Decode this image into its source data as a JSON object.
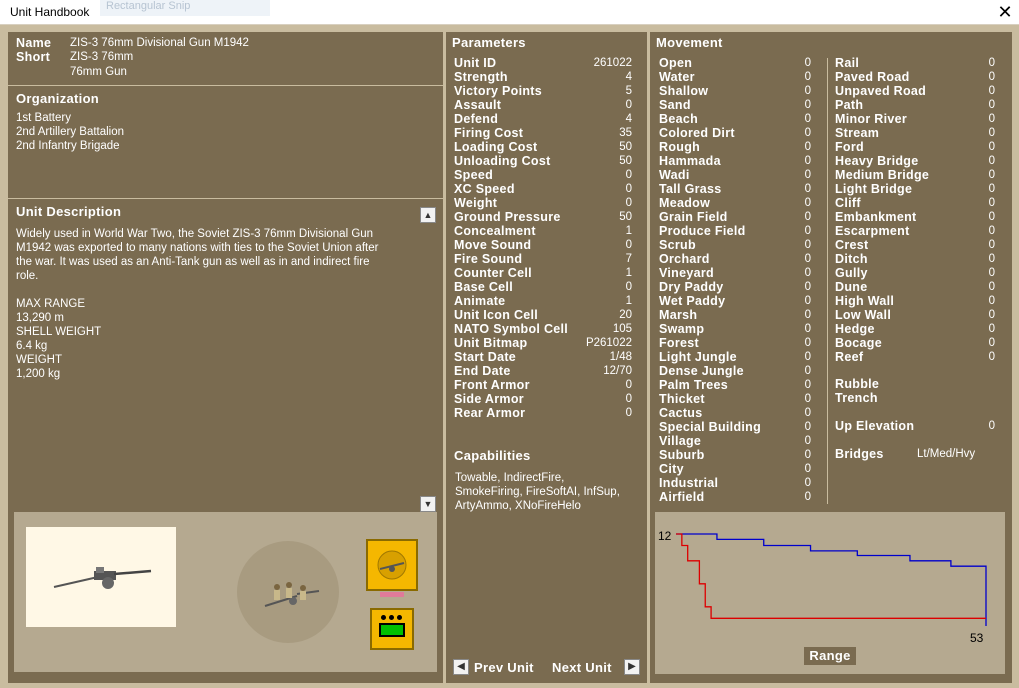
{
  "window": {
    "title": "Unit Handbook",
    "ghost_text": "Rectangular Snip"
  },
  "colors": {
    "panel": "#7a6b50",
    "frame": "#c9bc9f",
    "inset": "#b5a990",
    "blue_line": "#0000cc",
    "red_line": "#dd0000"
  },
  "unit": {
    "name_label": "Name",
    "short_label": "Short",
    "name": "ZIS-3 76mm Divisional Gun M1942",
    "short1": "ZIS-3 76mm",
    "short2": "76mm Gun"
  },
  "organization": {
    "header": "Organization",
    "lines": [
      "1st Battery",
      "2nd Artillery Battalion",
      "2nd Infantry Brigade"
    ]
  },
  "description": {
    "header": "Unit Description",
    "lines": [
      "Widely used in World War Two, the Soviet ZIS-3 76mm Divisional Gun",
      "M1942 was exported to many nations with ties to the Soviet Union after",
      "the war. It was used as an Anti-Tank gun as well as in and indirect fire",
      "role.",
      "",
      "MAX RANGE",
      "13,290 m",
      "SHELL WEIGHT",
      "6.4 kg",
      "WEIGHT",
      "1,200 kg"
    ]
  },
  "parameters": {
    "header": "Parameters",
    "rows": [
      {
        "label": "Unit ID",
        "value": "261022"
      },
      {
        "label": "Strength",
        "value": "4"
      },
      {
        "label": "Victory Points",
        "value": "5"
      },
      {
        "label": "Assault",
        "value": "0"
      },
      {
        "label": "Defend",
        "value": "4"
      },
      {
        "label": "Firing Cost",
        "value": "35"
      },
      {
        "label": "Loading Cost",
        "value": "50"
      },
      {
        "label": "Unloading Cost",
        "value": "50"
      },
      {
        "label": "Speed",
        "value": "0"
      },
      {
        "label": "XC Speed",
        "value": "0"
      },
      {
        "label": "Weight",
        "value": "0"
      },
      {
        "label": "Ground Pressure",
        "value": "50"
      },
      {
        "label": "Concealment",
        "value": "1"
      },
      {
        "label": "Move Sound",
        "value": "0"
      },
      {
        "label": "Fire Sound",
        "value": "7"
      },
      {
        "label": "Counter Cell",
        "value": "1"
      },
      {
        "label": "Base Cell",
        "value": "0"
      },
      {
        "label": "Animate",
        "value": "1"
      },
      {
        "label": "Unit Icon Cell",
        "value": "20"
      },
      {
        "label": "NATO Symbol Cell",
        "value": "105"
      },
      {
        "label": "Unit Bitmap",
        "value": "P261022"
      },
      {
        "label": "Start Date",
        "value": "1/48"
      },
      {
        "label": "End Date",
        "value": "12/70"
      },
      {
        "label": "Front Armor",
        "value": "0"
      },
      {
        "label": "Side Armor",
        "value": "0"
      },
      {
        "label": "Rear Armor",
        "value": "0"
      }
    ]
  },
  "capabilities": {
    "header": "Capabilities",
    "lines": [
      "Towable, IndirectFire,",
      "SmokeFiring, FireSoftAI, InfSup,",
      "ArtyAmmo, XNoFireHelo"
    ]
  },
  "movement": {
    "header": "Movement",
    "col1": [
      {
        "label": "Open",
        "value": "0"
      },
      {
        "label": "Water",
        "value": "0"
      },
      {
        "label": "Shallow",
        "value": "0"
      },
      {
        "label": "Sand",
        "value": "0"
      },
      {
        "label": "Beach",
        "value": "0"
      },
      {
        "label": "Colored Dirt",
        "value": "0"
      },
      {
        "label": "Rough",
        "value": "0"
      },
      {
        "label": "Hammada",
        "value": "0"
      },
      {
        "label": "Wadi",
        "value": "0"
      },
      {
        "label": "Tall Grass",
        "value": "0"
      },
      {
        "label": "Meadow",
        "value": "0"
      },
      {
        "label": "Grain Field",
        "value": "0"
      },
      {
        "label": "Produce Field",
        "value": "0"
      },
      {
        "label": "Scrub",
        "value": "0"
      },
      {
        "label": "Orchard",
        "value": "0"
      },
      {
        "label": "Vineyard",
        "value": "0"
      },
      {
        "label": "Dry Paddy",
        "value": "0"
      },
      {
        "label": "Wet Paddy",
        "value": "0"
      },
      {
        "label": "Marsh",
        "value": "0"
      },
      {
        "label": "Swamp",
        "value": "0"
      },
      {
        "label": "Forest",
        "value": "0"
      },
      {
        "label": "Light Jungle",
        "value": "0"
      },
      {
        "label": "Dense Jungle",
        "value": "0"
      },
      {
        "label": "Palm Trees",
        "value": "0"
      },
      {
        "label": "Thicket",
        "value": "0"
      },
      {
        "label": "Cactus",
        "value": "0"
      },
      {
        "label": "Special Building",
        "value": "0"
      },
      {
        "label": "Village",
        "value": "0"
      },
      {
        "label": "Suburb",
        "value": "0"
      },
      {
        "label": "City",
        "value": "0"
      },
      {
        "label": "Industrial",
        "value": "0"
      },
      {
        "label": "Airfield",
        "value": "0"
      }
    ],
    "col2": [
      {
        "label": "Rail",
        "value": "0"
      },
      {
        "label": "Paved Road",
        "value": "0"
      },
      {
        "label": "Unpaved Road",
        "value": "0"
      },
      {
        "label": "Path",
        "value": "0"
      },
      {
        "label": "Minor River",
        "value": "0"
      },
      {
        "label": "Stream",
        "value": "0"
      },
      {
        "label": "Ford",
        "value": "0"
      },
      {
        "label": "Heavy Bridge",
        "value": "0"
      },
      {
        "label": "Medium Bridge",
        "value": "0"
      },
      {
        "label": "Light Bridge",
        "value": "0"
      },
      {
        "label": "Cliff",
        "value": "0"
      },
      {
        "label": "Embankment",
        "value": "0"
      },
      {
        "label": "Escarpment",
        "value": "0"
      },
      {
        "label": "Crest",
        "value": "0"
      },
      {
        "label": "Ditch",
        "value": "0"
      },
      {
        "label": "Gully",
        "value": "0"
      },
      {
        "label": "Dune",
        "value": "0"
      },
      {
        "label": "High Wall",
        "value": "0"
      },
      {
        "label": "Low Wall",
        "value": "0"
      },
      {
        "label": "Hedge",
        "value": "0"
      },
      {
        "label": "Bocage",
        "value": "0"
      },
      {
        "label": "Reef",
        "value": "0"
      }
    ],
    "rubble": "Rubble",
    "trench": "Trench",
    "up_elevation": {
      "label": "Up Elevation",
      "value": "0"
    },
    "bridges": {
      "label": "Bridges",
      "value": "Lt/Med/Hvy"
    }
  },
  "nav": {
    "prev": "Prev Unit",
    "next": "Next Unit"
  },
  "icons": {
    "scroll_up": "scroll-up-icon",
    "scroll_down": "scroll-down-icon",
    "prev": "prev-arrow-icon",
    "next": "next-arrow-icon",
    "close": "close-icon"
  },
  "chart_data": {
    "type": "line",
    "xlabel": "Range",
    "x_min": 0,
    "x_max": 53,
    "y_max": 12,
    "y_tick_label": "12",
    "x_tick_label": "53",
    "series": [
      {
        "color": "#0000cc",
        "points": [
          [
            0,
            12
          ],
          [
            0,
            12
          ],
          [
            7,
            12
          ],
          [
            7,
            11.3
          ],
          [
            15,
            11.3
          ],
          [
            15,
            10.5
          ],
          [
            23,
            10.5
          ],
          [
            23,
            9.8
          ],
          [
            31,
            9.8
          ],
          [
            31,
            9.2
          ],
          [
            40,
            9.2
          ],
          [
            40,
            8.5
          ],
          [
            47,
            8.5
          ],
          [
            47,
            7.8
          ],
          [
            53,
            7.8
          ],
          [
            53,
            0
          ]
        ]
      },
      {
        "color": "#dd0000",
        "points": [
          [
            0,
            12
          ],
          [
            1,
            12
          ],
          [
            1,
            10.5
          ],
          [
            2,
            10.5
          ],
          [
            2,
            8.5
          ],
          [
            4,
            8.5
          ],
          [
            4,
            5.5
          ],
          [
            5,
            5.5
          ],
          [
            5,
            2.5
          ],
          [
            6,
            2.5
          ],
          [
            6,
            1.0
          ],
          [
            53,
            1.0
          ]
        ]
      }
    ]
  }
}
